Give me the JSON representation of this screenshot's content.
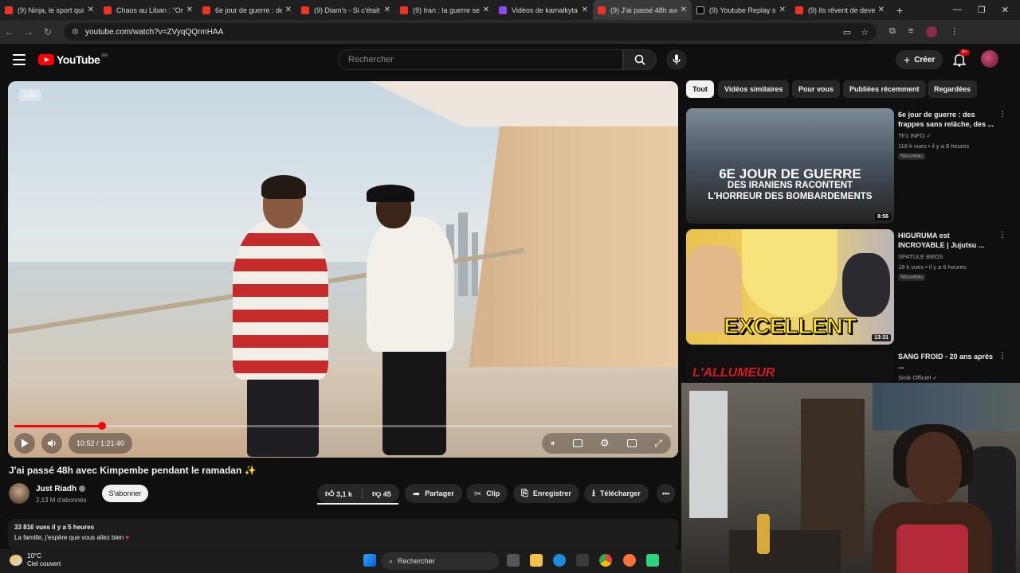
{
  "browser": {
    "tabs": [
      {
        "title": "(9) Ninja, le sport qui",
        "icon": "youtube-icon",
        "active": false
      },
      {
        "title": "Chaos au Liban : \"On",
        "icon": "youtube-icon",
        "active": false
      },
      {
        "title": "6e jour de guerre : de",
        "icon": "youtube-icon",
        "active": false
      },
      {
        "title": "(9) Diam's - Si c'était",
        "icon": "youtube-icon",
        "active": false
      },
      {
        "title": "(9) Iran : la guerre se",
        "icon": "youtube-icon",
        "active": false
      },
      {
        "title": "Vidéos de kamalkyta",
        "icon": "twitch-icon",
        "active": false
      },
      {
        "title": "(9) J'ai passé 48h ave",
        "icon": "youtube-icon",
        "active": true
      },
      {
        "title": "(9) Youtube Replay s",
        "icon": "x-icon",
        "active": false
      },
      {
        "title": "(9) Ils rêvent de deve",
        "icon": "youtube-icon",
        "active": false
      }
    ],
    "url": "youtube.com/watch?v=ZVyqQQrmHAA"
  },
  "header": {
    "logo_text": "YouTube",
    "logo_region": "FR",
    "search_placeholder": "Rechercher",
    "create_label": "Créer",
    "notif_count": "9+"
  },
  "player": {
    "speed": "1.50",
    "time": "10:52 / 1:21:40",
    "progress": 0.133
  },
  "video": {
    "title": "J'ai passé 48h avec Kimpembe pendant le ramadan ✨",
    "channel": "Just Riadh",
    "subscribers": "2,13 M d'abonnés",
    "subscribe_label": "S'abonner",
    "likes": "3,1 k",
    "dislikes": "45",
    "share_label": "Partager",
    "clip_label": "Clip",
    "save_label": "Enregistrer",
    "download_label": "Télécharger",
    "views_meta": "33 816 vues  il y a 5 heures",
    "description": "La famille, j'espère que vous allez bien"
  },
  "chips": [
    "Tout",
    "Vidéos similaires",
    "Pour vous",
    "Publiées récemment",
    "Regardées"
  ],
  "related": [
    {
      "title": "6e jour de guerre : des frappes sans relâche, des ...",
      "channel": "TF1 INFO",
      "meta": "118 k vues • il y a 8 heures",
      "badge": "Nouveau",
      "duration": "8:56",
      "thumb_line1": "6E JOUR DE GUERRE",
      "thumb_line2": "DES IRANIENS RACONTENT",
      "thumb_line3": "L'HORREUR DES BOMBARDEMENTS"
    },
    {
      "title": "HIGURUMA est INCROYABLE | Jujutsu ...",
      "channel": "SPATULE BROS",
      "meta": "18 k vues • il y a 6 heures",
      "badge": "Nouveau",
      "duration": "13:31",
      "thumb_text": "EXCELLENT"
    },
    {
      "title": "SANG FROID - 20 ans après ...",
      "channel": "Sinik Officiel",
      "thumb_text": "L'ALLUMEUR"
    }
  ],
  "taskbar": {
    "temperature": "10°C",
    "weather": "Ciel couvert",
    "search_label": "Rechercher"
  },
  "colors": {
    "accent": "#ff0000",
    "background": "#0f0f0f",
    "chip_bg": "#272727"
  }
}
